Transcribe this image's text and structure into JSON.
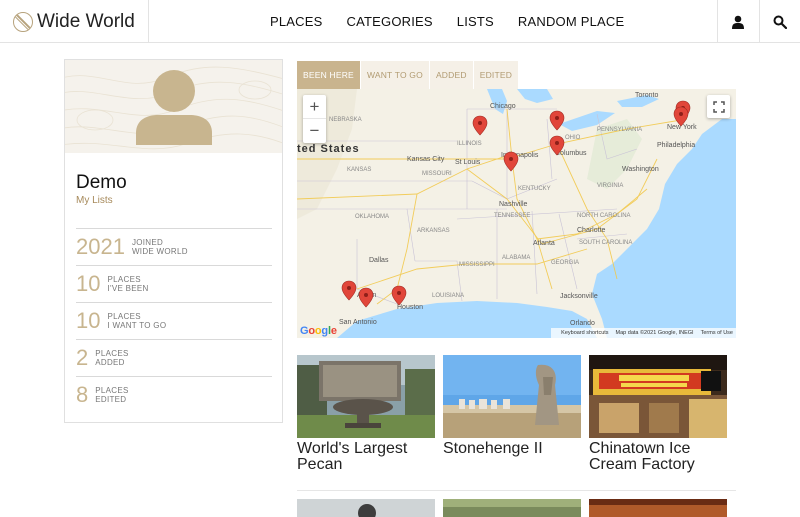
{
  "header": {
    "brand": "Wide World",
    "nav": [
      "PLACES",
      "CATEGORIES",
      "LISTS",
      "RANDOM PLACE"
    ],
    "user_icon": "user-icon",
    "search_icon": "search-icon"
  },
  "profile": {
    "name": "Demo",
    "link": "My Lists",
    "stats": [
      {
        "number": "2021",
        "label": "JOINED\nWIDE WORLD"
      },
      {
        "number": "10",
        "label": "PLACES\nI'VE BEEN"
      },
      {
        "number": "10",
        "label": "PLACES\nI WANT TO GO"
      },
      {
        "number": "2",
        "label": "PLACES\nADDED"
      },
      {
        "number": "8",
        "label": "PLACES\nEDITED"
      }
    ]
  },
  "tabs": [
    {
      "label": "BEEN HERE",
      "active": true
    },
    {
      "label": "WANT TO GO",
      "active": false
    },
    {
      "label": "ADDED",
      "active": false
    },
    {
      "label": "EDITED",
      "active": false
    }
  ],
  "map": {
    "zoom_in": "+",
    "zoom_out": "−",
    "labels": [
      "Chicago",
      "ILLINOIS",
      "Indianapolis",
      "Columbus",
      "St Louis",
      "NEBRASKA",
      "KANSAS",
      "OKLAHOMA",
      "KENTUCKY",
      "Nashville",
      "TENNESSEE",
      "Atlanta",
      "Charlotte",
      "Washington",
      "New York",
      "PENNSYLVANIA",
      "VIRGINIA",
      "NORTH CAROLINA",
      "SOUTH CAROLINA",
      "ARKANSAS",
      "ALABAMA",
      "GEORGIA",
      "MISSISSIPPI",
      "LOUISIANA",
      "Dallas",
      "Austin",
      "Houston",
      "San Antonio",
      "Jacksonville",
      "Orlando",
      "Toronto",
      "MISSOURI",
      "OHIO",
      "Philadelphia",
      "Kansas City",
      "ted States"
    ],
    "google": "Google",
    "footer": [
      "Keyboard shortcuts",
      "Map data ©2021 Google, INEGI",
      "Terms of Use"
    ]
  },
  "places": [
    {
      "title": "World's Largest Pecan"
    },
    {
      "title": "Stonehenge II"
    },
    {
      "title": "Chinatown Ice Cream Factory"
    }
  ]
}
